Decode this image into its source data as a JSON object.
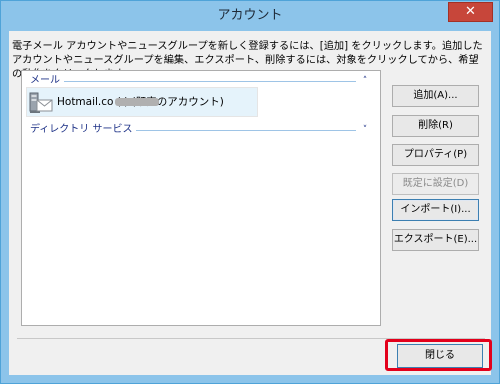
{
  "window": {
    "title": "アカウント",
    "close_glyph": "✕"
  },
  "description": "電子メール アカウントやニュースグループを新しく登録するには、[追加] をクリックします。追加したアカウントやニュースグループを編集、エクスポート、削除するには、対象をクリックしてから、希望の動作をクリックします。",
  "list": {
    "groups": [
      {
        "label": "メール",
        "chevron": "˄"
      },
      {
        "label": "ディレクトリ サービス",
        "chevron": "˅"
      }
    ],
    "account": {
      "name": "Hotmail.co (                ) (既定のアカウント)",
      "icon": "mail-account-icon"
    }
  },
  "buttons": {
    "add": "追加(A)...",
    "delete": "削除(R)",
    "properties": "プロパティ(P)",
    "set_default": "既定に設定(D)",
    "import": "インポート(I)...",
    "export": "エクスポート(E)...",
    "close": "閉じる"
  },
  "colors": {
    "titlebar": "#8cc4ea",
    "highlight": "#e3001b",
    "group_text": "#1e3287"
  }
}
